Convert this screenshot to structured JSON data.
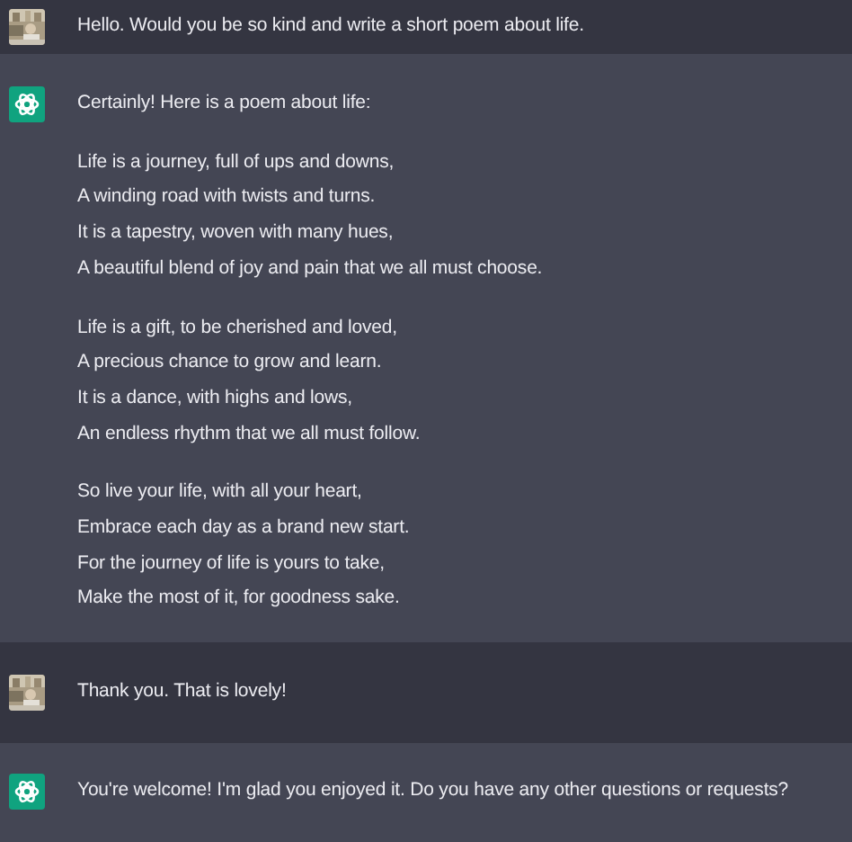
{
  "messages": [
    {
      "kind": "user",
      "blocks": [
        [
          "Hello. Would you be so kind and write a short poem about life."
        ]
      ]
    },
    {
      "kind": "assistant",
      "blocks": [
        [
          "Certainly! Here is a poem about life:"
        ],
        [
          "Life is a journey, full of ups and downs,",
          "A winding road with twists and turns.",
          "It is a tapestry, woven with many hues,",
          "A beautiful blend of joy and pain that we all must choose."
        ],
        [
          "Life is a gift, to be cherished and loved,",
          "A precious chance to grow and learn.",
          "It is a dance, with highs and lows,",
          "An endless rhythm that we all must follow."
        ],
        [
          "So live your life, with all your heart,",
          "Embrace each day as a brand new start.",
          "For the journey of life is yours to take,",
          "Make the most of it, for goodness sake."
        ]
      ]
    },
    {
      "kind": "user",
      "blocks": [
        [
          "Thank you. That is lovely!"
        ]
      ]
    },
    {
      "kind": "assistant",
      "blocks": [
        [
          "You're welcome! I'm glad you enjoyed it. Do you have any other questions or requests?"
        ]
      ]
    }
  ]
}
